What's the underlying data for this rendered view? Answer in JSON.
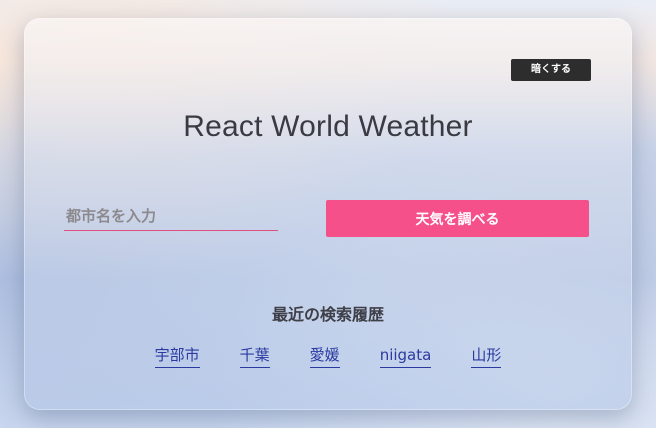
{
  "theme_toggle": {
    "label": "暗くする"
  },
  "app": {
    "title": "React World Weather"
  },
  "search": {
    "placeholder": "都市名を入力",
    "value": "",
    "button_label": "天気を調べる"
  },
  "history": {
    "title": "最近の検索履歴",
    "items": [
      {
        "label": "宇部市"
      },
      {
        "label": "千葉"
      },
      {
        "label": "愛媛"
      },
      {
        "label": "niigata"
      },
      {
        "label": "山形"
      }
    ]
  },
  "colors": {
    "accent": "#f5508a",
    "link": "#2b3aa0",
    "dark_button": "#2d2d2d"
  }
}
